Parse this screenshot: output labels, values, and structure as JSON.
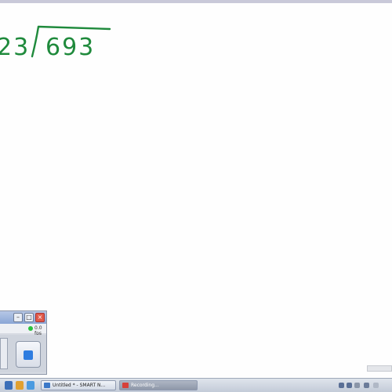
{
  "whiteboard": {
    "divisor": "23",
    "dividend": "693",
    "ink_color": "#1f8a3c"
  },
  "recorder": {
    "fps_label": "0.0 fps",
    "status_color": "#28c33c",
    "stop_icon": "stop-square-icon",
    "stop_color": "#2f7de0"
  },
  "taskbar": {
    "tasks": [
      {
        "label": "Untitled * - SMART N...",
        "icon": "notebook-icon"
      },
      {
        "label": "Recording...",
        "icon": "recorder-icon"
      }
    ],
    "tray_icons": [
      "network-icon",
      "volume-icon",
      "clock-icon"
    ]
  }
}
